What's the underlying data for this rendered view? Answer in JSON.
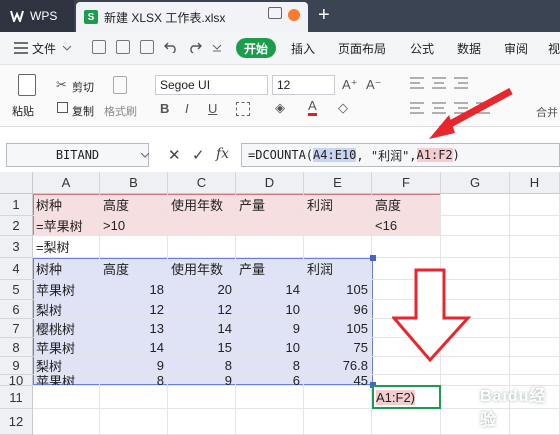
{
  "titlebar": {
    "app": "WPS",
    "doc_title": "新建 XLSX 工作表.xlsx",
    "plus": "+"
  },
  "menu": {
    "file": "文件",
    "start": "开始",
    "insert": "插入",
    "layout": "页面布局",
    "formula": "公式",
    "data": "数据",
    "review": "审阅",
    "view": "视"
  },
  "ribbon": {
    "paste": "粘贴",
    "cut": "剪切",
    "copy": "复制",
    "format_painter": "格式刷",
    "font_name": "Segoe UI",
    "font_size": "12",
    "merge_center": "合并"
  },
  "formula_bar": {
    "name_box": "BITAND",
    "fx": "fx",
    "formula_prefix": "=DCOUNTA(",
    "ref_a": "A4:E10",
    "formula_mid": ", \"利润\", ",
    "ref_b": "A1:F2",
    "formula_suffix": ")"
  },
  "columns": [
    "A",
    "B",
    "C",
    "D",
    "E",
    "F",
    "G",
    "H"
  ],
  "rows": [
    "1",
    "2",
    "3",
    "4",
    "5",
    "6",
    "7",
    "8",
    "9",
    "10",
    "11",
    "12"
  ],
  "criteria": {
    "headers": [
      "树种",
      "高度",
      "使用年数",
      "产量",
      "利润",
      "高度"
    ],
    "row2": [
      "=苹果树",
      ">10",
      "",
      "",
      "",
      "<16"
    ],
    "row3": "=梨树"
  },
  "table": {
    "headers": [
      "树种",
      "高度",
      "使用年数",
      "产量",
      "利润"
    ],
    "rows": [
      [
        "苹果树",
        "18",
        "20",
        "14",
        "105"
      ],
      [
        "梨树",
        "12",
        "12",
        "10",
        "96"
      ],
      [
        "樱桃树",
        "13",
        "14",
        "9",
        "105"
      ],
      [
        "苹果树",
        "14",
        "15",
        "10",
        "75"
      ],
      [
        "梨树",
        "9",
        "8",
        "8",
        "76.8"
      ],
      [
        "苹果树",
        "8",
        "9",
        "6",
        "45"
      ]
    ]
  },
  "active_cell_text": "A1:F2)",
  "colors": {
    "accent": "#1e9c4e",
    "criteria_fill": "#f6dfe0",
    "table_fill": "#dfe3f5",
    "arrow": "#e8262b"
  }
}
